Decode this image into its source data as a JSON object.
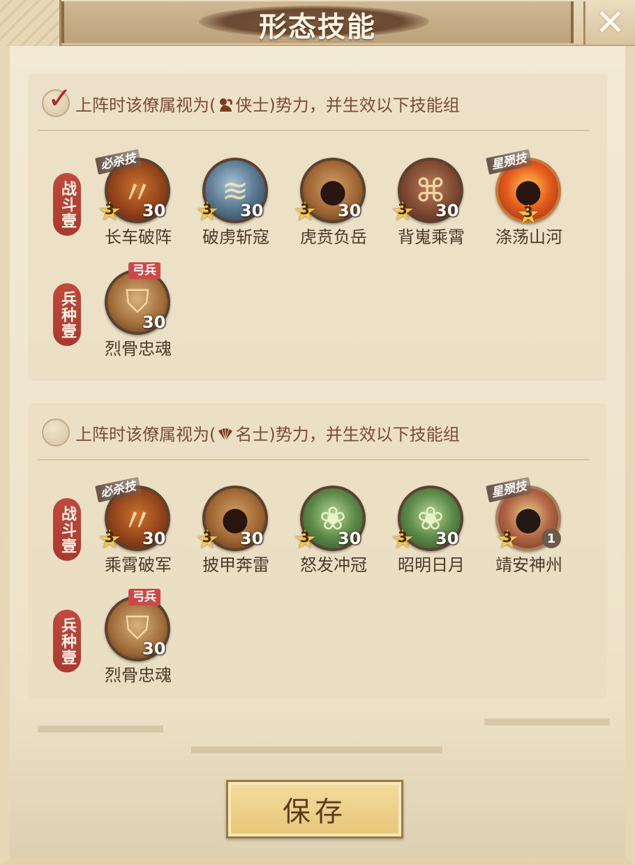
{
  "header": {
    "title": "形态技能",
    "close_glyph": "✕"
  },
  "groups": [
    {
      "checked": true,
      "text_before": "上阵时该僚属视为(",
      "faction_icon": "knight-silhouette-icon",
      "faction_name": "侠士",
      "text_after": ")势力，并生效以下技能组",
      "rows": [
        {
          "label": "战斗壹",
          "skills": [
            {
              "name": "长车破阵",
              "star": "3",
              "level": "30",
              "badge": "必杀技",
              "icon": "fire-slash-icon",
              "style": "fire"
            },
            {
              "name": "破虏斩寇",
              "star": "3",
              "level": "30",
              "badge": "",
              "icon": "ice-strike-icon",
              "style": "ice"
            },
            {
              "name": "虎贲负岳",
              "star": "3",
              "level": "30",
              "badge": "",
              "icon": "warrior-aura-icon",
              "style": "tiger"
            },
            {
              "name": "背嵬乘霄",
              "star": "3",
              "level": "30",
              "badge": "",
              "icon": "shield-claw-icon",
              "style": "brown"
            },
            {
              "name": "涤荡山河",
              "star": "3",
              "level": "",
              "badge": "星殒技",
              "icon": "flame-demon-icon",
              "style": "flame"
            }
          ]
        },
        {
          "label": "兵种壹",
          "skills": [
            {
              "name": "烈骨忠魂",
              "star": "",
              "level": "30",
              "badge_red": "弓兵",
              "icon": "shield-icon",
              "style": "shield"
            }
          ]
        }
      ]
    },
    {
      "checked": false,
      "text_before": "上阵时该僚属视为(",
      "faction_icon": "fan-icon",
      "faction_name": "名士",
      "text_after": ")势力，并生效以下技能组",
      "rows": [
        {
          "label": "战斗壹",
          "skills": [
            {
              "name": "乘霄破军",
              "star": "3",
              "level": "30",
              "badge": "必杀技",
              "icon": "fire-slash-icon",
              "style": "fire"
            },
            {
              "name": "披甲奔雷",
              "star": "3",
              "level": "30",
              "badge": "",
              "icon": "warrior-aura-icon",
              "style": "tiger"
            },
            {
              "name": "怒发冲冠",
              "star": "3",
              "level": "30",
              "badge": "",
              "icon": "lotus-icon",
              "style": "green"
            },
            {
              "name": "昭明日月",
              "star": "3",
              "level": "30",
              "badge": "",
              "icon": "lotus-icon",
              "style": "green"
            },
            {
              "name": "靖安神州",
              "star": "3",
              "level_circle": "1",
              "badge": "星殒技",
              "icon": "flame-demon-icon",
              "style": "flame"
            }
          ]
        },
        {
          "label": "兵种壹",
          "skills": [
            {
              "name": "烈骨忠魂",
              "star": "",
              "level": "30",
              "badge_red": "弓兵",
              "icon": "shield-icon",
              "style": "shield"
            }
          ]
        }
      ]
    }
  ],
  "footer": {
    "save_label": "保存"
  },
  "colors": {
    "accent_red": "#b5272b",
    "label_red": "#bf4a3e",
    "text_brown": "#4a3a2a",
    "save_gold": "#e7c677"
  }
}
